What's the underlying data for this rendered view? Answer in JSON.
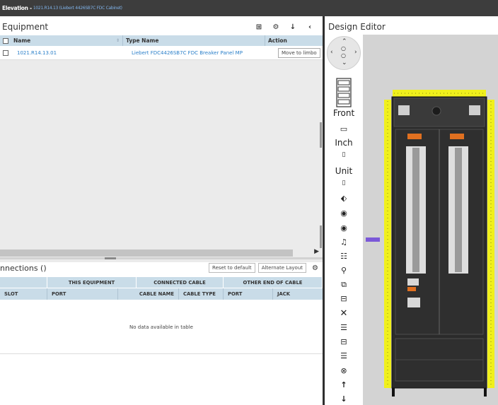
{
  "header": {
    "title": "Elevation - ",
    "subtitle": "1021.R14.13 (Liebert 4426SB7C FDC Cabinet)"
  },
  "equipment": {
    "title": "Equipment",
    "icons": [
      "add-icon",
      "gear-icon",
      "download-icon",
      "collapse-icon"
    ],
    "columns": {
      "name": "Name",
      "type": "Type Name",
      "action": "Action"
    },
    "rows": [
      {
        "name": "1021.R14.13.01",
        "type": "Liebert FDC4426SB7C FDC Breaker Panel MP",
        "action": "Move to limbo"
      }
    ]
  },
  "connections": {
    "title": "nnections ()",
    "reset_label": "Reset to default",
    "alternate_label": "Alternate Layout",
    "groups": [
      "THIS EQUIPMENT",
      "CONNECTED CABLE",
      "OTHER END OF CABLE"
    ],
    "columns": [
      "SLOT",
      "PORT",
      "CABLE NAME",
      "CABLE TYPE",
      "PORT",
      "JACK"
    ],
    "empty_text": "No data available in table"
  },
  "design_editor": {
    "title": "Design Editor",
    "labels": {
      "front": "Front",
      "inch": "Inch",
      "unit": "Unit"
    },
    "tools": [
      "ruler-icon",
      "tag-icon",
      "eye-icon",
      "eye-icon",
      "bell-icon",
      "add-rows-icon",
      "add-node-icon",
      "add-stack-icon",
      "connect-icon",
      "close-icon",
      "columns-icon",
      "connect-icon",
      "columns-icon",
      "cancel-icon",
      "arrow-up-icon",
      "arrow-down-icon"
    ],
    "colors": {
      "cabinet_frame": "#f0f01c",
      "cabinet_body": "#2b2b2b",
      "canvas_bg": "#d3d3d3",
      "marker": "#7b58d8"
    }
  }
}
